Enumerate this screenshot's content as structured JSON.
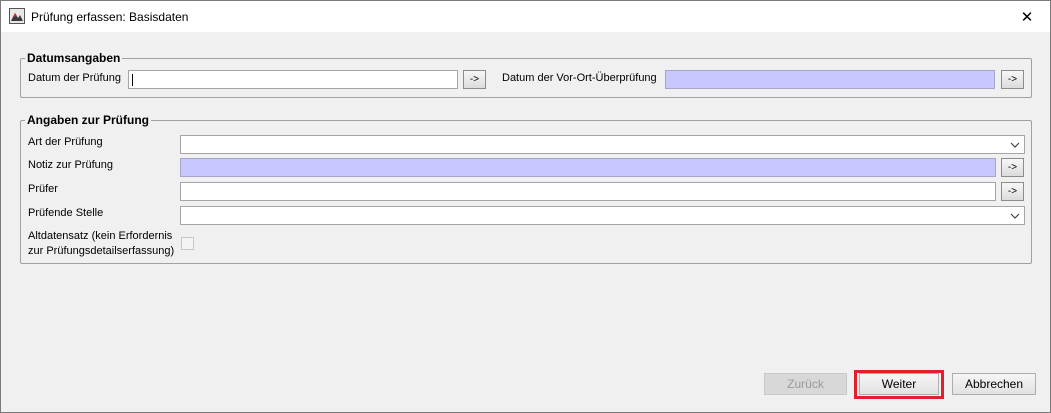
{
  "window": {
    "title": "Prüfung erfassen: Basisdaten",
    "close_glyph": "✕"
  },
  "datumsangaben": {
    "legend": "Datumsangaben",
    "datum_pruefung_label": "Datum der Prüfung",
    "datum_pruefung_value": "",
    "datum_vorort_label": "Datum der Vor-Ort-Überprüfung",
    "datum_vorort_value": ""
  },
  "angaben": {
    "legend": "Angaben zur Prüfung",
    "art_label": "Art der Prüfung",
    "art_value": "",
    "notiz_label": "Notiz zur Prüfung",
    "notiz_value": "",
    "pruefer_label": "Prüfer",
    "pruefer_value": "",
    "stelle_label": "Prüfende Stelle",
    "stelle_value": "",
    "altdaten_label_line1": "Altdatensatz (kein Erfordernis",
    "altdaten_label_line2": "zur Prüfungsdetailserfassung)",
    "altdaten_checked": false
  },
  "buttons": {
    "arrow": "->",
    "zurueck": "Zurück",
    "weiter": "Weiter",
    "abbrechen": "Abbrechen"
  },
  "colors": {
    "readonly_field": "#c8c8ff",
    "highlight": "#e0202a"
  }
}
